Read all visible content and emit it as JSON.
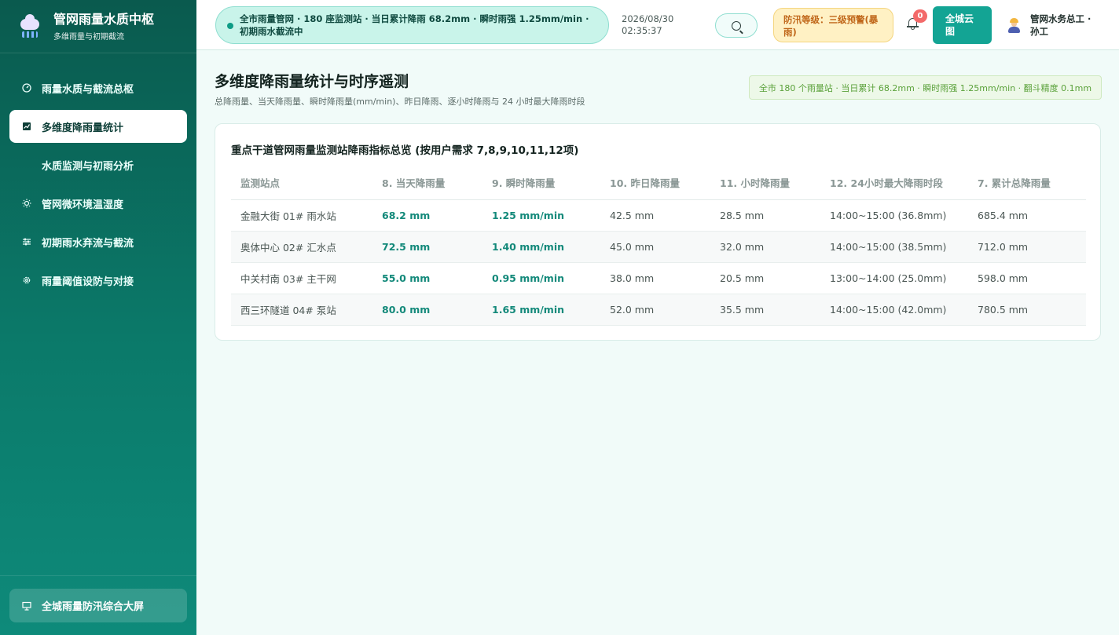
{
  "brand": {
    "title": "管网雨量水质中枢",
    "subtitle": "多维雨量与初期截流"
  },
  "nav": {
    "items": [
      {
        "label": "雨量水质与截流总枢",
        "icon": "gauge-icon"
      },
      {
        "label": "多维度降雨量统计",
        "icon": "chart-icon",
        "active": true
      },
      {
        "label": "水质监测与初雨分析",
        "icon": ""
      },
      {
        "label": "管网微环境温湿度",
        "icon": "sun-icon"
      },
      {
        "label": "初期雨水弃流与截流",
        "icon": "sliders-icon"
      },
      {
        "label": "雨量阈值设防与对接",
        "icon": "gear-icon"
      }
    ],
    "footer_label": "全城雨量防汛综合大屏"
  },
  "header": {
    "ticker": "全市雨量管网 · 180 座监测站 · 当日累计降雨 68.2mm · 瞬时雨强 1.25mm/min · 初期雨水截流中",
    "date": "2026/08/30",
    "time": "02:35:37",
    "alert": "防汛等级：三级预警(暴雨)",
    "notification_count": "0",
    "cloud_button": "全城云图",
    "user": "管网水务总工 · 孙工"
  },
  "main": {
    "title": "多维度降雨量统计与时序遥测",
    "subtitle": "总降雨量、当天降雨量、瞬时降雨量(mm/min)、昨日降雨、逐小时降雨与 24 小时最大降雨时段",
    "summary": "全市 180 个雨量站 · 当日累计 68.2mm · 瞬时雨强 1.25mm/min · 翻斗精度 0.1mm"
  },
  "table": {
    "title": "重点干道管网雨量监测站降雨指标总览 (按用户需求 7,8,9,10,11,12项)",
    "columns": [
      "监测站点",
      "8. 当天降雨量",
      "9. 瞬时降雨量",
      "10. 昨日降雨量",
      "11. 小时降雨量",
      "12. 24小时最大降雨时段",
      "7. 累计总降雨量"
    ],
    "rows": [
      [
        "金融大街 01# 雨水站",
        "68.2 mm",
        "1.25 mm/min",
        "42.5 mm",
        "28.5 mm",
        "14:00~15:00 (36.8mm)",
        "685.4 mm"
      ],
      [
        "奥体中心 02# 汇水点",
        "72.5 mm",
        "1.40 mm/min",
        "45.0 mm",
        "32.0 mm",
        "14:00~15:00 (38.5mm)",
        "712.0 mm"
      ],
      [
        "中关村南 03# 主干网",
        "55.0 mm",
        "0.95 mm/min",
        "38.0 mm",
        "20.5 mm",
        "13:00~14:00 (25.0mm)",
        "598.0 mm"
      ],
      [
        "西三环隧道 04# 泵站",
        "80.0 mm",
        "1.65 mm/min",
        "52.0 mm",
        "35.5 mm",
        "14:00~15:00 (42.0mm)",
        "780.5 mm"
      ]
    ]
  }
}
